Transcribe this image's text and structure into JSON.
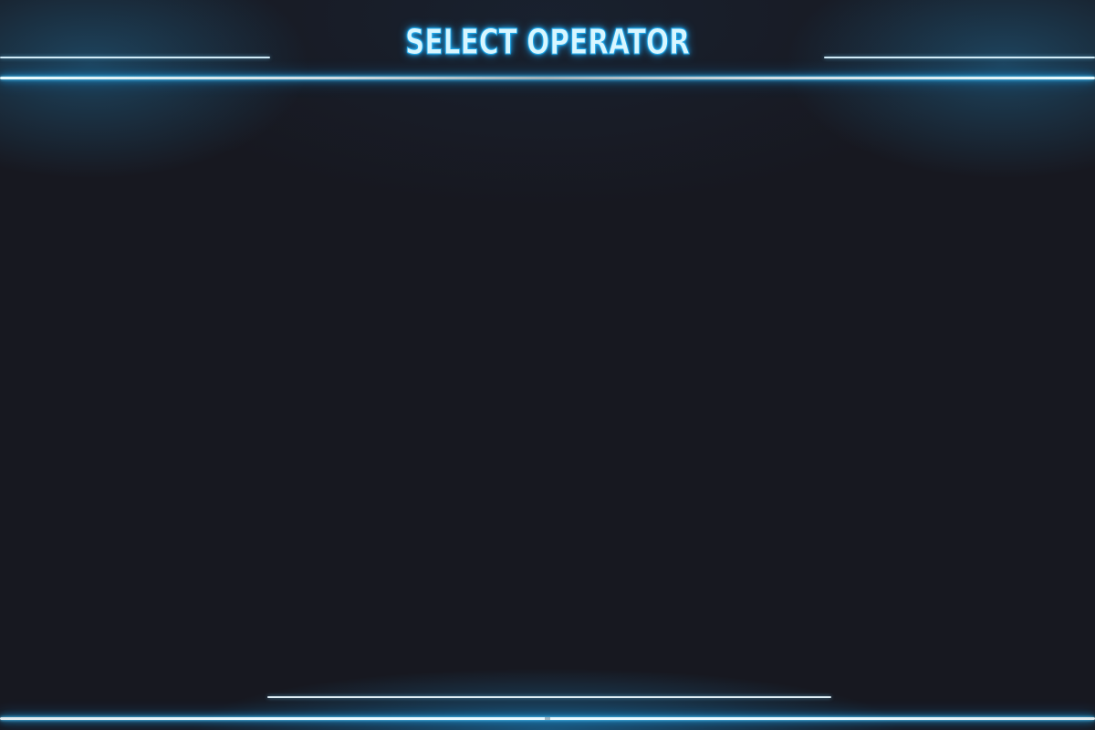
{
  "screen": {
    "title": "SELECT OPERATOR"
  },
  "colors": {
    "background": "#171820",
    "glow": "#1fb2ff",
    "line": "#e6fbff",
    "title_fill": "#d8f6ff"
  }
}
